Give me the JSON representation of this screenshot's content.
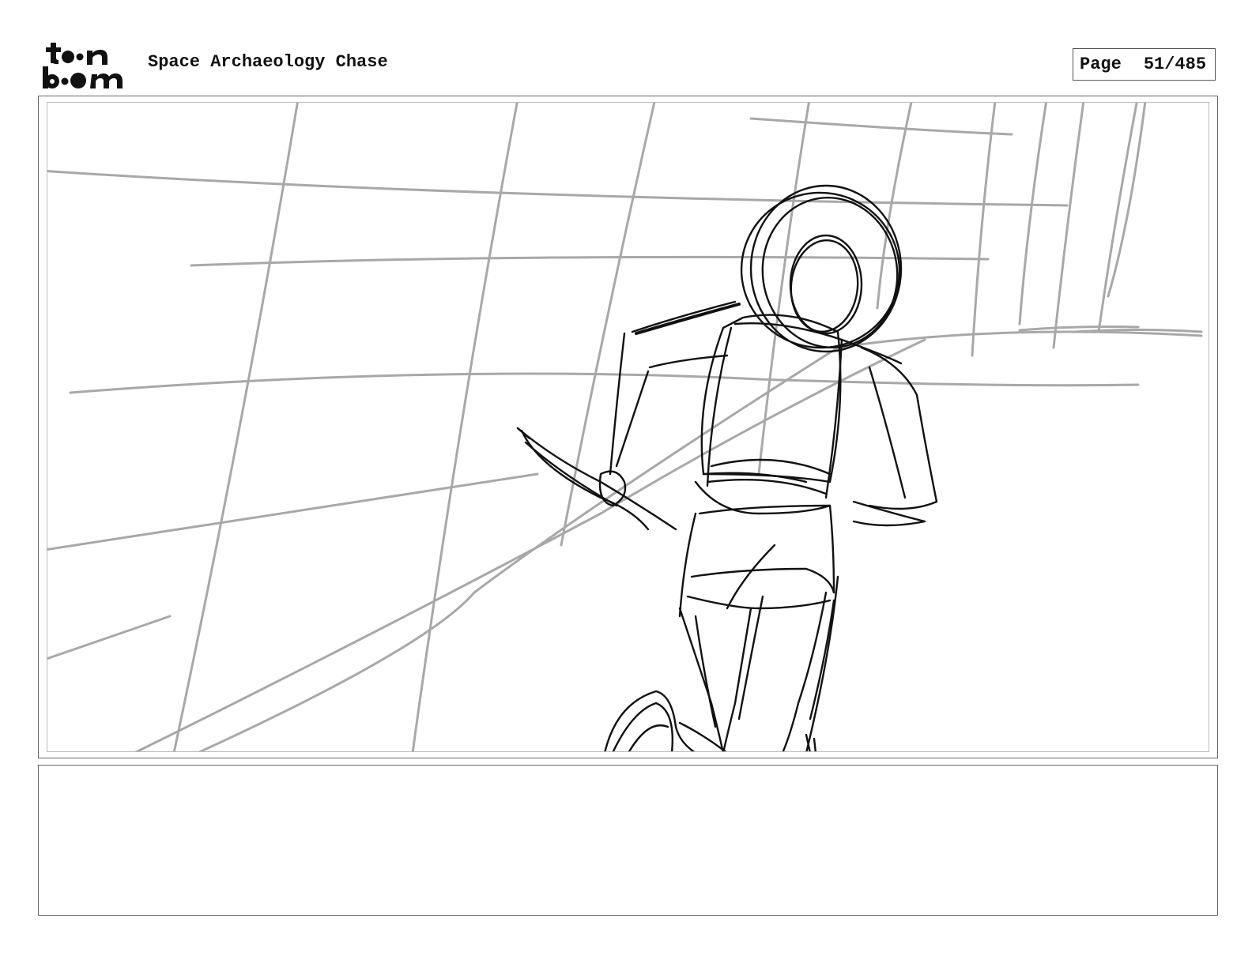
{
  "header": {
    "logo_text": "toonboom",
    "title": "Space Archaeology Chase",
    "page_label": "Page",
    "page_number": "51/485"
  },
  "panel": {
    "content": "rough sketch"
  },
  "notes": {
    "text": ""
  }
}
